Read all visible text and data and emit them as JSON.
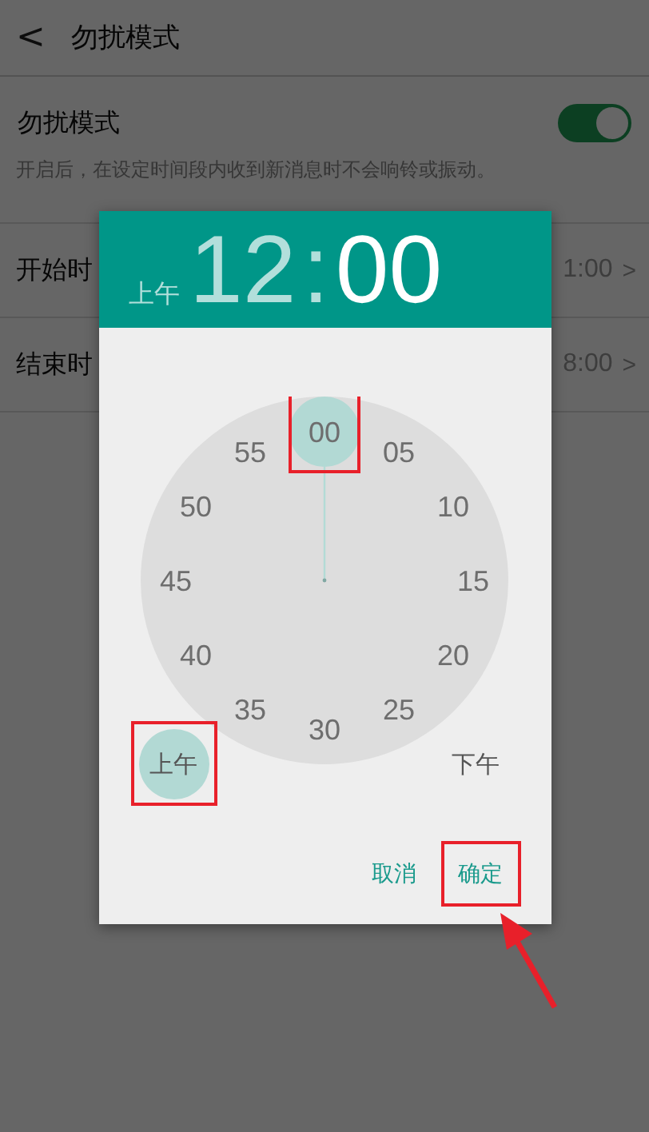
{
  "top_bar": {
    "back": "<",
    "title": "勿扰模式"
  },
  "setting": {
    "label": "勿扰模式",
    "on": true,
    "description": "开启后，在设定时间段内收到新消息时不会响铃或振动。"
  },
  "time_rows": [
    {
      "label": "开始时",
      "value": "1:00",
      "chevron": ">"
    },
    {
      "label": "结束时",
      "value": "8:00",
      "chevron": ">"
    }
  ],
  "time_picker": {
    "header": {
      "period": "上午",
      "hour": {
        "text": "12",
        "selected": false
      },
      "separator": ":",
      "minute": {
        "text": "00",
        "selected": true
      }
    },
    "dial": [
      {
        "text": "00",
        "selected": true,
        "highlighted": true
      },
      {
        "text": "05",
        "selected": false,
        "highlighted": false
      },
      {
        "text": "10",
        "selected": false,
        "highlighted": false
      },
      {
        "text": "15",
        "selected": false,
        "highlighted": false
      },
      {
        "text": "20",
        "selected": false,
        "highlighted": false
      },
      {
        "text": "25",
        "selected": false,
        "highlighted": false
      },
      {
        "text": "30",
        "selected": false,
        "highlighted": false
      },
      {
        "text": "35",
        "selected": false,
        "highlighted": false
      },
      {
        "text": "40",
        "selected": false,
        "highlighted": false
      },
      {
        "text": "45",
        "selected": false,
        "highlighted": false
      },
      {
        "text": "50",
        "selected": false,
        "highlighted": false
      },
      {
        "text": "55",
        "selected": false,
        "highlighted": false
      }
    ],
    "periods": [
      {
        "text": "上午",
        "selected": true,
        "highlighted": true
      },
      {
        "text": "下午",
        "selected": false,
        "highlighted": false
      }
    ],
    "buttons": [
      {
        "text": "取消",
        "highlighted": false,
        "pointer": false
      },
      {
        "text": "确定",
        "highlighted": true,
        "pointer": true
      }
    ]
  }
}
